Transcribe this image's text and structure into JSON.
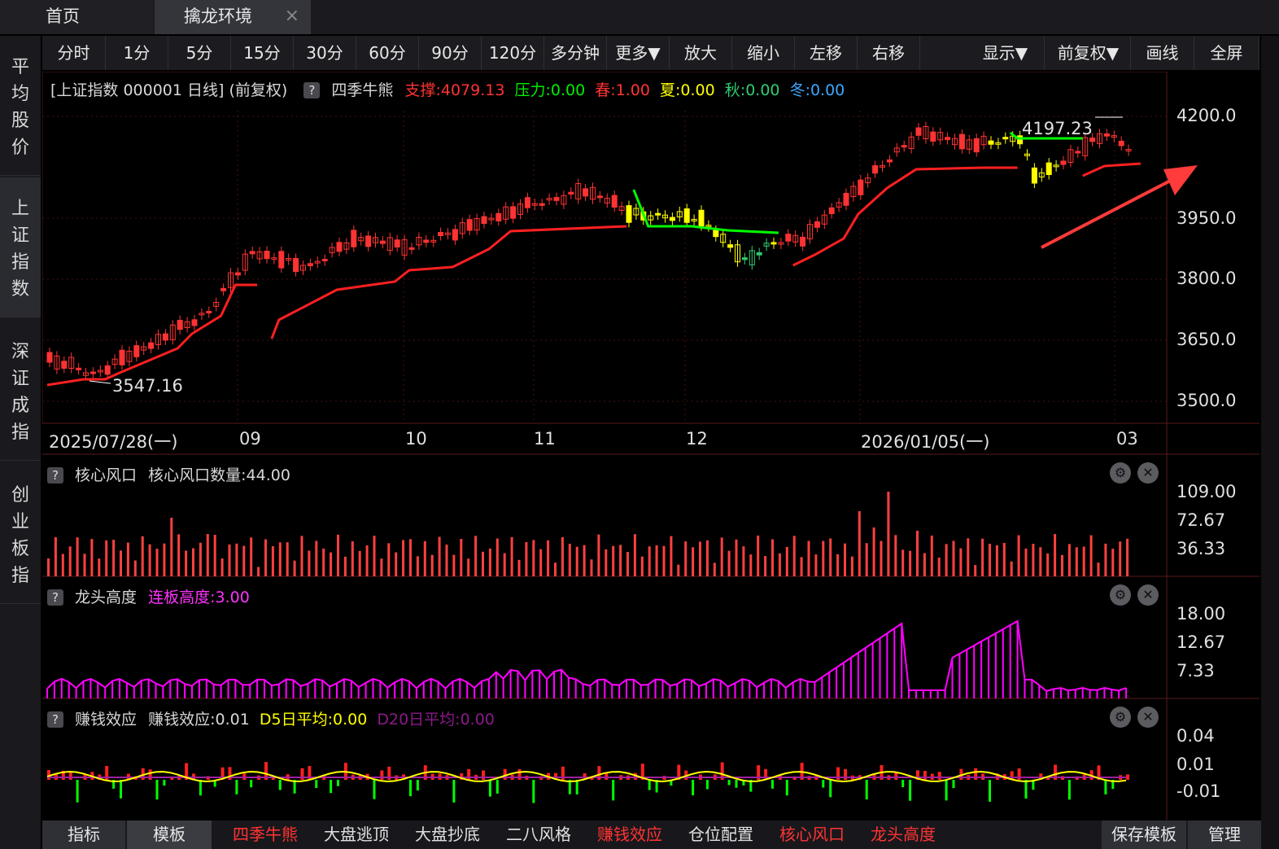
{
  "tabs": {
    "home": "首页",
    "active": "擒龙环境",
    "close": "×"
  },
  "toolbar": [
    "分时",
    "1分",
    "5分",
    "15分",
    "30分",
    "60分",
    "90分",
    "120分",
    "多分钟",
    "更多▼",
    "放大",
    "缩小",
    "左移",
    "右移",
    "显示▼",
    "前复权▼",
    "画线",
    "全屏"
  ],
  "sidebar": [
    [
      "平",
      "均",
      "股",
      "价"
    ],
    [
      "上",
      "证",
      "指",
      "数"
    ],
    [
      "深",
      "证",
      "成",
      "指"
    ],
    [
      "创",
      "业",
      "板",
      "指"
    ]
  ],
  "main_header": {
    "title": "[上证指数 000001 日线] (前复权)",
    "help": "?",
    "indicator": "四季牛熊",
    "support": "支撑:4079.13",
    "pressure": "压力:0.00",
    "spring": "春:1.00",
    "summer": "夏:0.00",
    "autumn": "秋:0.00",
    "winter": "冬:0.00"
  },
  "price_axis": [
    "4200.0",
    "3950.0",
    "3800.0",
    "3650.0",
    "3500.0"
  ],
  "annotations": {
    "high": "4197.23",
    "low": "3547.16"
  },
  "date_axis": [
    "2025/07/28(一)",
    "09",
    "10",
    "11",
    "12",
    "2026/01/05(一)",
    "03"
  ],
  "panel1": {
    "help": "?",
    "name": "核心风口",
    "value": "核心风口数量:44.00",
    "axis": [
      "109.00",
      "72.67",
      "36.33"
    ]
  },
  "panel2": {
    "help": "?",
    "name": "龙头高度",
    "value": "连板高度:3.00",
    "axis": [
      "18.00",
      "12.67",
      "7.33"
    ]
  },
  "panel3": {
    "help": "?",
    "name": "赚钱效应",
    "value": "赚钱效应:0.01",
    "d5": "D5日平均:0.00",
    "d20": "D20日平均:0.00",
    "axis": [
      "0.04",
      "0.01",
      "-0.01"
    ]
  },
  "bottom": {
    "indicator_btn": "指标",
    "template_btn": "模板",
    "tabs": [
      "四季牛熊",
      "大盘逃顶",
      "大盘抄底",
      "二八风格",
      "赚钱效应",
      "仓位配置",
      "核心风口",
      "龙头高度"
    ],
    "save": "保存模板",
    "manage": "管理"
  },
  "colors": {
    "up": "#ff3333",
    "down": "#00ff00",
    "yellow": "#ffff00",
    "magenta": "#ff00ff",
    "support": "#ff2020",
    "bg": "#000000"
  },
  "icons": {
    "gear": "gear-icon",
    "close": "close-circle-icon",
    "arrow": "red-arrow-annotation"
  }
}
